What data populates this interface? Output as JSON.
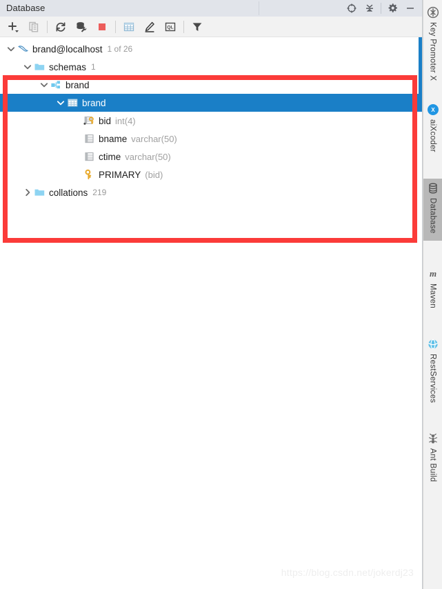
{
  "window": {
    "title": "Database",
    "header_actions": [
      {
        "name": "scroll-from-source-icon",
        "label": "Scroll from Source"
      },
      {
        "name": "collapse-all-icon",
        "label": "Collapse All"
      },
      {
        "name": "settings-gear-icon",
        "label": "Settings"
      },
      {
        "name": "hide-icon",
        "label": "Hide"
      }
    ]
  },
  "toolbar": {
    "buttons": [
      {
        "name": "add-icon",
        "label": "New"
      },
      {
        "name": "copy-icon",
        "label": "Duplicate"
      },
      {
        "name": "refresh-icon",
        "label": "Refresh"
      },
      {
        "name": "database-tools-icon",
        "label": "Database Tools"
      },
      {
        "name": "stop-icon",
        "label": "Stop"
      },
      {
        "name": "jump-to-table-icon",
        "label": "Jump to Table"
      },
      {
        "name": "modify-icon",
        "label": "Modify"
      },
      {
        "name": "query-console-icon",
        "label": "Open Query Console"
      },
      {
        "name": "filter-icon",
        "label": "Filter"
      }
    ],
    "stop_color": "#ec5d5b"
  },
  "tree": {
    "selection_color": "#1a7fc7",
    "rows": [
      {
        "name": "data-source-brand-localhost",
        "icon": "mysql-dolphin-icon",
        "twisty": "expanded",
        "indent": 0,
        "label": "brand@localhost",
        "sub": "1 of 26",
        "type": "",
        "selected": false
      },
      {
        "name": "tree-node-schemas",
        "icon": "folder-icon",
        "twisty": "expanded",
        "indent": 1,
        "label": "schemas",
        "sub": "1",
        "type": "",
        "selected": false
      },
      {
        "name": "tree-node-schema-brand",
        "icon": "schema-icon",
        "twisty": "expanded",
        "indent": 2,
        "label": "brand",
        "sub": "",
        "type": "",
        "selected": false
      },
      {
        "name": "tree-node-table-brand",
        "icon": "table-icon",
        "twisty": "expanded",
        "indent": 3,
        "label": "brand",
        "sub": "",
        "type": "",
        "selected": true
      },
      {
        "name": "tree-node-column-bid",
        "icon": "primary-key-column-icon",
        "twisty": "none",
        "indent": 4,
        "label": "bid",
        "sub": "",
        "type": "int(4)",
        "selected": false
      },
      {
        "name": "tree-node-column-bname",
        "icon": "column-icon",
        "twisty": "none",
        "indent": 4,
        "label": "bname",
        "sub": "",
        "type": "varchar(50)",
        "selected": false
      },
      {
        "name": "tree-node-column-ctime",
        "icon": "column-icon",
        "twisty": "none",
        "indent": 4,
        "label": "ctime",
        "sub": "",
        "type": "varchar(50)",
        "selected": false
      },
      {
        "name": "tree-node-key-primary",
        "icon": "key-icon",
        "twisty": "none",
        "indent": 4,
        "label": "PRIMARY",
        "sub": "",
        "type": "(bid)",
        "selected": false
      },
      {
        "name": "tree-node-collations",
        "icon": "folder-icon",
        "twisty": "collapsed",
        "indent": 1,
        "label": "collations",
        "sub": "219",
        "type": "",
        "selected": false
      }
    ]
  },
  "annotation": {
    "name": "red-highlight-box",
    "color": "#fb3b39"
  },
  "watermark": {
    "text": "https://blog.csdn.net/jokerdj23"
  },
  "sidebar": {
    "tabs": [
      {
        "name": "sidebar-tab-key-promoter-x",
        "icon": "key-promoter-icon",
        "label": "Key Promoter X",
        "active": false
      },
      {
        "name": "sidebar-tab-aixcoder",
        "icon": "aixcoder-icon",
        "label": "aiXcoder",
        "active": false
      },
      {
        "name": "sidebar-tab-database",
        "icon": "database-cylinder-icon",
        "label": "Database",
        "active": true
      },
      {
        "name": "sidebar-tab-maven",
        "icon": "maven-icon",
        "label": "Maven",
        "active": false
      },
      {
        "name": "sidebar-tab-restservices",
        "icon": "restservices-icon",
        "label": "RestServices",
        "active": false
      },
      {
        "name": "sidebar-tab-ant-build",
        "icon": "ant-icon",
        "label": "Ant Build",
        "active": false
      }
    ]
  }
}
